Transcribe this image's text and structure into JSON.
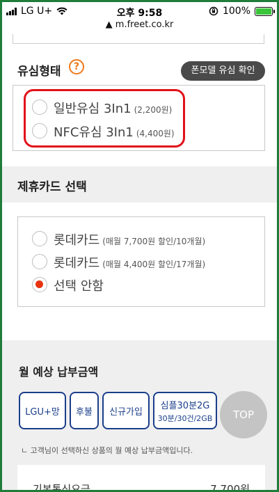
{
  "status_bar": {
    "carrier": "LG U+",
    "time": "오후 9:58",
    "battery": "100%",
    "url": "m.freet.co.kr"
  },
  "sim_section": {
    "title": "유심형태",
    "help_icon": "?",
    "model_check_button": "폰모델 유심 확인",
    "options": [
      {
        "label": "일반유심 3In1",
        "price": "(2,200원)",
        "selected": false
      },
      {
        "label": "NFC유심 3In1",
        "price": "(4,400원)",
        "selected": false
      }
    ]
  },
  "card_section": {
    "title": "제휴카드 선택",
    "options": [
      {
        "label": "롯데카드",
        "detail": "(매월 7,700원 할인/10개월)",
        "selected": false
      },
      {
        "label": "롯데카드",
        "detail": "(매월 4,400원 할인/17개월)",
        "selected": false
      },
      {
        "label": "선택 안함",
        "detail": "",
        "selected": true
      }
    ]
  },
  "estimate_section": {
    "title": "월 예상 납부금액",
    "chips": [
      {
        "label": "LGU+망",
        "sub": ""
      },
      {
        "label": "후불",
        "sub": ""
      },
      {
        "label": "신규가입",
        "sub": ""
      },
      {
        "label": "심플30분2G",
        "sub": "30분/30건/2GB"
      }
    ],
    "top_button": "TOP",
    "note": "ㄴ 고객님이 선택하신 상품의 월 예상 납부금액입니다.",
    "fee_label": "기본통신요금",
    "fee_value": "7,700원"
  },
  "colors": {
    "accent_orange": "#f07818",
    "radio_selected": "#e8320f",
    "chip_border": "#1a3e8a",
    "highlight_red": "#e1111a"
  }
}
